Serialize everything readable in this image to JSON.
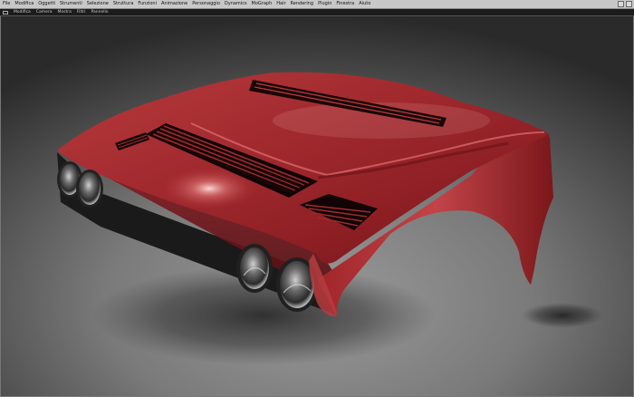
{
  "menu": {
    "items": [
      "File",
      "Modifica",
      "Oggetti",
      "Strumenti",
      "Selezione",
      "Struttura",
      "Funzioni",
      "Animazione",
      "Personaggio",
      "Dynamics",
      "MoGraph",
      "Hair",
      "Rendering",
      "Plugin",
      "Finestra",
      "Aiuto"
    ]
  },
  "viewport_menu": {
    "items": [
      "Modifica",
      "Camera",
      "Mostra",
      "Filtri",
      "Pannello"
    ]
  },
  "colors": {
    "car_body": "#a82a2e",
    "car_highlight": "#f5b8b6",
    "car_shadow": "#3a0c0e",
    "background_top": "#2c2c2c",
    "background_floor": "#8d8d8d"
  }
}
